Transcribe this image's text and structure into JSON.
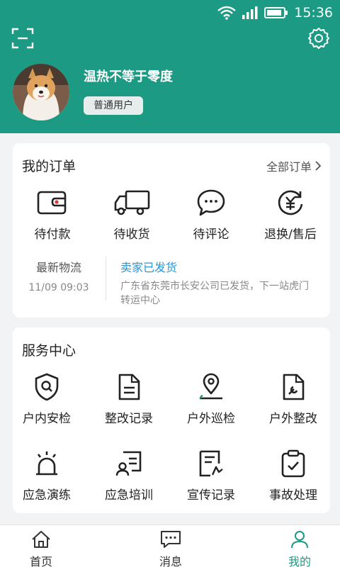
{
  "status_bar": {
    "time": "15:36"
  },
  "profile": {
    "username": "温热不等于零度",
    "role": "普通用户"
  },
  "orders": {
    "title": "我的订单",
    "all_link": "全部订单",
    "items": [
      {
        "label": "待付款",
        "icon": "wallet-icon"
      },
      {
        "label": "待收货",
        "icon": "truck-icon"
      },
      {
        "label": "待评论",
        "icon": "comment-icon"
      },
      {
        "label": "退换/售后",
        "icon": "refund-icon"
      }
    ],
    "logistics": {
      "title": "最新物流",
      "time": "11/09 09:03",
      "status": "卖家已发货",
      "detail": "广东省东莞市长安公司已发货，下一站虎门转运中心"
    }
  },
  "services": {
    "title": "服务中心",
    "items": [
      {
        "label": "户内安检",
        "icon": "shield-search-icon"
      },
      {
        "label": "整改记录",
        "icon": "document-icon"
      },
      {
        "label": "户外巡检",
        "icon": "location-pin-icon"
      },
      {
        "label": "户外整改",
        "icon": "wrench-doc-icon"
      },
      {
        "label": "应急演练",
        "icon": "alarm-light-icon"
      },
      {
        "label": "应急培训",
        "icon": "training-icon"
      },
      {
        "label": "宣传记录",
        "icon": "publicity-icon"
      },
      {
        "label": "事故处理",
        "icon": "clipboard-check-icon"
      }
    ]
  },
  "tabbar": {
    "active": "我的",
    "items": [
      {
        "label": "首页",
        "icon": "home-icon"
      },
      {
        "label": "消息",
        "icon": "message-icon"
      },
      {
        "label": "我的",
        "icon": "user-icon"
      }
    ]
  },
  "colors": {
    "brand": "#1c9a84",
    "link": "#2a95d8",
    "accent_red": "#e0353b"
  }
}
